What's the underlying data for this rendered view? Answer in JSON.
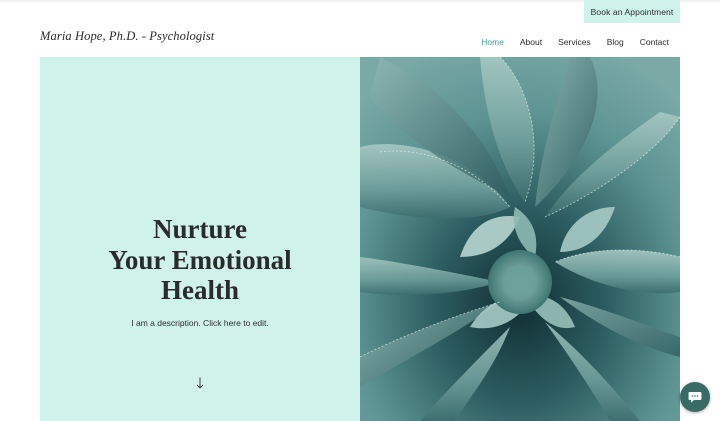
{
  "header": {
    "site_title": "Maria Hope, Ph.D. - Psychologist",
    "cta_label": "Book an Appointment",
    "nav": [
      {
        "label": "Home",
        "active": true
      },
      {
        "label": "About",
        "active": false
      },
      {
        "label": "Services",
        "active": false
      },
      {
        "label": "Blog",
        "active": false
      },
      {
        "label": "Contact",
        "active": false
      }
    ]
  },
  "hero": {
    "title_lines": [
      "Nurture",
      "Your Emotional",
      "Health"
    ],
    "description": "I am a description. Click here to edit.",
    "scroll_icon": "arrow-down-icon",
    "image": "succulent-plant-photo"
  },
  "chat": {
    "icon": "chat-bubble-icon"
  },
  "colors": {
    "accent_mint": "#cff3eb",
    "active_nav": "#48a09a",
    "text": "#2f2f2f",
    "chat_bg": "#3a6a66"
  }
}
